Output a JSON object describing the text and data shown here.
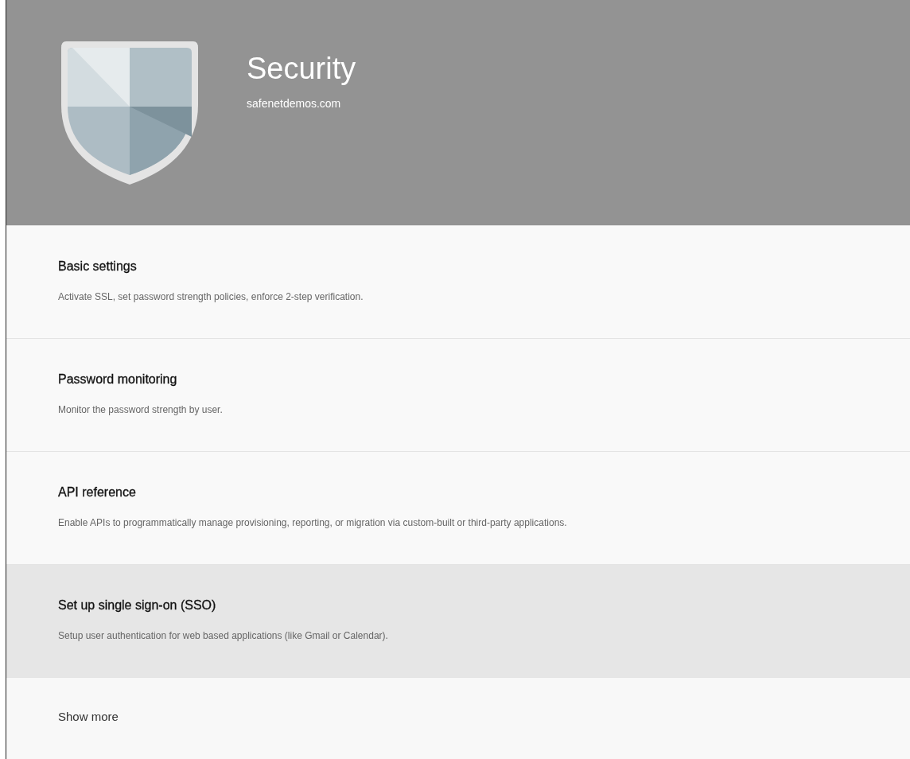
{
  "header": {
    "title": "Security",
    "domain": "safenetdemos.com"
  },
  "settings": [
    {
      "title": "Basic settings",
      "description": "Activate SSL, set password strength policies, enforce 2-step verification.",
      "highlighted": false
    },
    {
      "title": "Password monitoring",
      "description": "Monitor the password strength by user.",
      "highlighted": false
    },
    {
      "title": "API reference",
      "description": "Enable APIs to programmatically manage provisioning, reporting, or migration via custom-built or third-party applications.",
      "highlighted": false
    },
    {
      "title": "Set up single sign-on (SSO)",
      "description": "Setup user authentication for web based applications (like Gmail or Calendar).",
      "highlighted": true
    }
  ],
  "show_more": "Show more"
}
